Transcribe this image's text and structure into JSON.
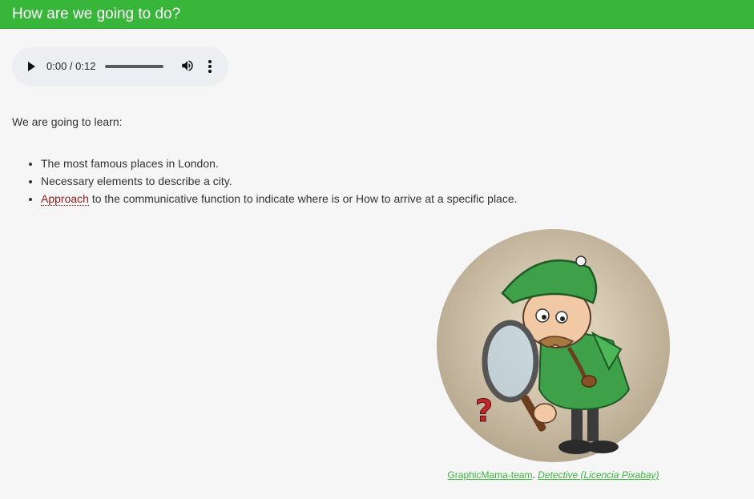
{
  "header": {
    "title": "How are we going to do?"
  },
  "audio": {
    "time": "0:00 / 0:12",
    "icons": [
      "play-icon",
      "volume-icon",
      "more-vert-icon"
    ],
    "progress": 0
  },
  "intro": "We are going to learn:",
  "goals": {
    "item1": "The most famous places in London.",
    "item2": "Necessary elements to describe a city.",
    "item3_term": "Approach",
    "item3_rest": " to the communicative function to indicate where is or How to arrive at a specific place."
  },
  "figure": {
    "icon": "detective-illustration"
  },
  "caption": {
    "author": "GraphicMama-team",
    "separator": ". ",
    "title": "Detective (Licencia Pixabay)"
  },
  "colors": {
    "header_bg": "#38b63a",
    "link": "#38b63a",
    "term": "#8b1a1a",
    "page_bg": "#f6f6f6"
  }
}
